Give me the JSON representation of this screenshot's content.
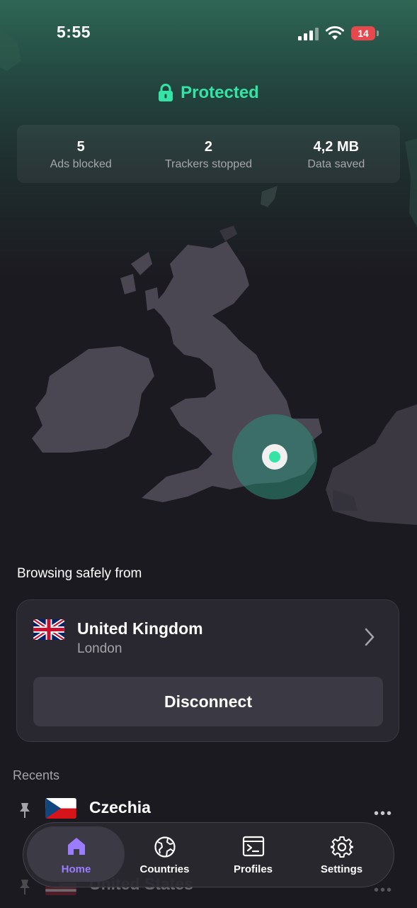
{
  "status_bar": {
    "time": "5:55",
    "battery": "14"
  },
  "header": {
    "status": "Protected",
    "status_color": "#33e4a6",
    "icon": "lock-icon"
  },
  "stats": [
    {
      "value": "5",
      "label": "Ads blocked"
    },
    {
      "value": "2",
      "label": "Trackers stopped"
    },
    {
      "value": "4,2 MB",
      "label": "Data saved"
    }
  ],
  "map": {
    "location_marker_color": "#33e4a6"
  },
  "connection": {
    "section_label": "Browsing safely from",
    "country": "United Kingdom",
    "city": "London",
    "flag": "uk-flag-icon",
    "disconnect_label": "Disconnect"
  },
  "recents": {
    "label": "Recents",
    "items": [
      {
        "name": "Czechia",
        "flag": "czech-flag-icon"
      },
      {
        "name": "United States",
        "flag": "us-flag-icon"
      }
    ]
  },
  "tab_bar": {
    "active": "Home",
    "accent": "#9b7cff",
    "tabs": [
      {
        "label": "Home",
        "icon": "home-icon"
      },
      {
        "label": "Countries",
        "icon": "globe-icon"
      },
      {
        "label": "Profiles",
        "icon": "terminal-icon"
      },
      {
        "label": "Settings",
        "icon": "gear-icon"
      }
    ]
  }
}
